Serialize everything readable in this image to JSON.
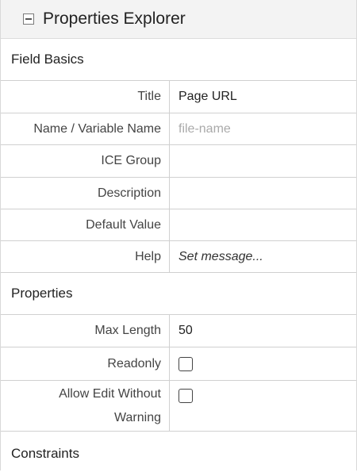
{
  "header": {
    "title": "Properties Explorer"
  },
  "sections": {
    "field_basics": {
      "title": "Field Basics",
      "rows": {
        "title": {
          "label": "Title",
          "value": "Page URL"
        },
        "name": {
          "label": "Name / Variable Name",
          "placeholder": "file-name"
        },
        "ice_group": {
          "label": "ICE Group",
          "value": ""
        },
        "description": {
          "label": "Description",
          "value": ""
        },
        "default_value": {
          "label": "Default Value",
          "value": ""
        },
        "help": {
          "label": "Help",
          "value": "Set message..."
        }
      }
    },
    "properties": {
      "title": "Properties",
      "rows": {
        "max_length": {
          "label": "Max Length",
          "value": "50"
        },
        "readonly": {
          "label": "Readonly",
          "checked": false
        },
        "allow_edit": {
          "label_line1": "Allow Edit Without",
          "label_line2": "Warning",
          "checked": false
        }
      }
    },
    "constraints": {
      "title": "Constraints"
    }
  },
  "icons": {
    "collapse": "minus-square-icon"
  }
}
